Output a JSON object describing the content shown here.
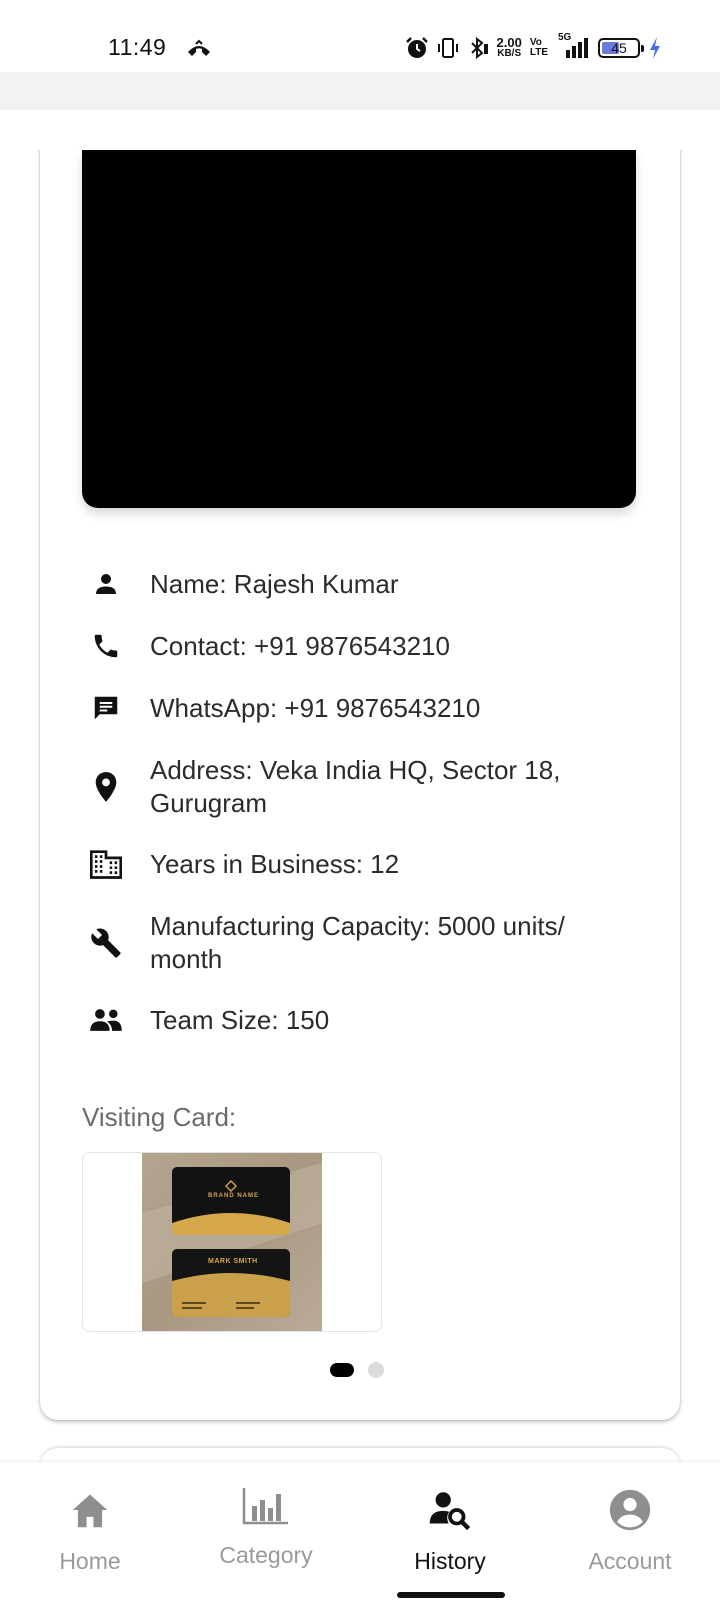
{
  "status_bar": {
    "time": "11:49",
    "net_speed_value": "2.00",
    "net_speed_unit": "KB/S",
    "volte_top": "Vo",
    "volte_bottom": "LTE",
    "network": "5G",
    "battery_percent": "45",
    "battery_level": 0.45,
    "icons": [
      "missed-call-icon",
      "alarm-icon",
      "vibrate-icon",
      "bluetooth-icon",
      "signal-icon",
      "battery-icon",
      "charging-icon"
    ]
  },
  "details": [
    {
      "icon": "person-icon",
      "text": "Name: Rajesh Kumar"
    },
    {
      "icon": "phone-icon",
      "text": "Contact: +91 9876543210"
    },
    {
      "icon": "chat-icon",
      "text": "WhatsApp: +91 9876543210"
    },
    {
      "icon": "location-pin-icon",
      "text": "Address: Veka India HQ, Sector 18, Gurugram"
    },
    {
      "icon": "building-icon",
      "text": "Years in Business: 12"
    },
    {
      "icon": "wrench-icon",
      "text": "Manufacturing Capacity: 5000 units/ month"
    },
    {
      "icon": "group-icon",
      "text": "Team Size: 150"
    }
  ],
  "visiting_card": {
    "label": "Visiting Card:",
    "card1_brand": "BRAND NAME",
    "card2_name": "MARK SMITH"
  },
  "carousel": {
    "total": 2,
    "active": 1
  },
  "bottom_nav": {
    "items": [
      {
        "label": "Home",
        "icon": "home-icon",
        "active": false
      },
      {
        "label": "Category",
        "icon": "bar-chart-icon",
        "active": false
      },
      {
        "label": "History",
        "icon": "person-search-icon",
        "active": true
      },
      {
        "label": "Account",
        "icon": "account-circle-icon",
        "active": false
      }
    ]
  },
  "colors": {
    "accent_active": "#111111",
    "inactive": "#9a9a9a",
    "battery_fill": "#6f7bdc",
    "charging": "#4a6cf0"
  }
}
